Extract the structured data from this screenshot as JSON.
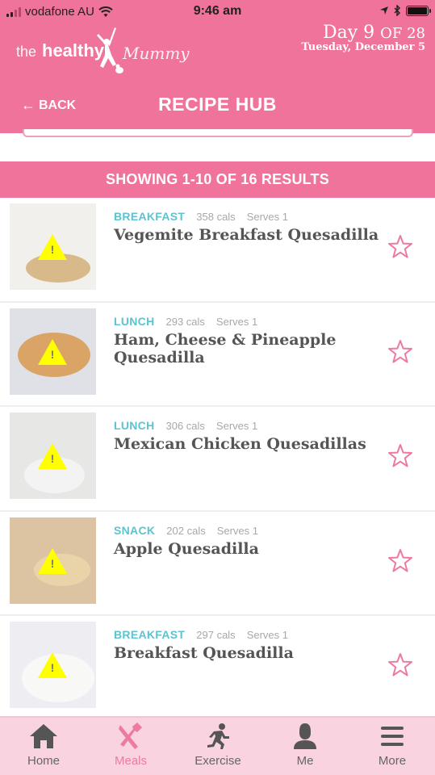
{
  "status_bar": {
    "carrier": "vodafone AU",
    "time": "9:46 am"
  },
  "header": {
    "logo": {
      "the": "the",
      "healthy": "healthy",
      "mummy": "Mummy"
    },
    "day_label": "Day 9",
    "day_of": "OF 28",
    "date": "Tuesday, December 5",
    "back_label": "BACK",
    "title": "RECIPE HUB"
  },
  "results": {
    "summary": "SHOWING 1-10 OF 16 RESULTS"
  },
  "recipes": [
    {
      "category": "BREAKFAST",
      "cals": "358 cals",
      "serves": "Serves  1",
      "title": "Vegemite Breakfast Quesadilla",
      "favorite": false
    },
    {
      "category": "LUNCH",
      "cals": "293 cals",
      "serves": "Serves  1",
      "title": "Ham, Cheese & Pineapple Quesadilla",
      "favorite": false
    },
    {
      "category": "LUNCH",
      "cals": "306 cals",
      "serves": "Serves  1",
      "title": "Mexican Chicken Quesadillas",
      "favorite": false
    },
    {
      "category": "SNACK",
      "cals": "202 cals",
      "serves": "Serves  1",
      "title": "Apple Quesadilla",
      "favorite": false
    },
    {
      "category": "BREAKFAST",
      "cals": "297 cals",
      "serves": "Serves  1",
      "title": "Breakfast Quesadilla",
      "favorite": false
    }
  ],
  "tabbar": {
    "items": [
      {
        "label": "Home",
        "icon": "home-icon",
        "active": false
      },
      {
        "label": "Meals",
        "icon": "utensils-icon",
        "active": true
      },
      {
        "label": "Exercise",
        "icon": "running-icon",
        "active": false
      },
      {
        "label": "Me",
        "icon": "person-icon",
        "active": false
      },
      {
        "label": "More",
        "icon": "menu-icon",
        "active": false
      }
    ]
  },
  "colors": {
    "brand_pink": "#f0739b",
    "category_teal": "#5cc3d0",
    "tabbar_bg": "#f9d3e0",
    "active_tab": "#ec7aa1"
  }
}
